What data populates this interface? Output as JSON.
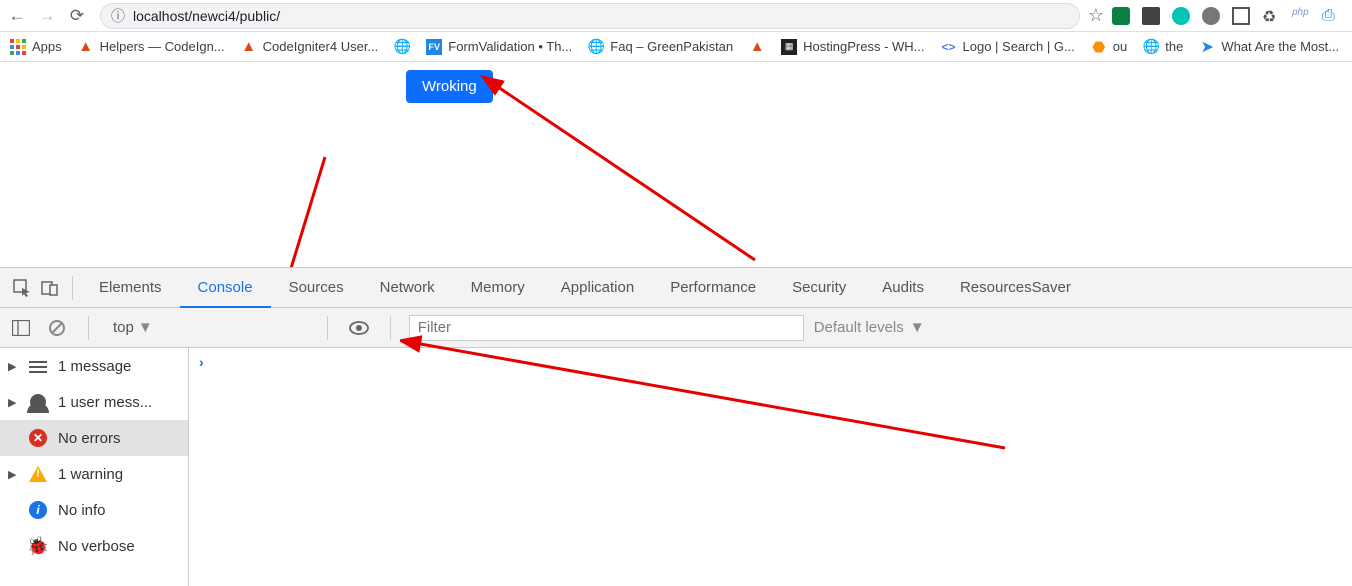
{
  "nav": {
    "url": "localhost/newci4/public/"
  },
  "bookmarks": {
    "apps": "Apps",
    "items": [
      "Helpers — CodeIgn...",
      "CodeIgniter4 User...",
      "FormValidation • Th...",
      "Faq – GreenPakistan",
      "HostingPress - WH...",
      "Logo | Search | G...",
      "ou",
      "the",
      "What Are the Most..."
    ]
  },
  "page": {
    "button_label": "Wroking"
  },
  "devtools": {
    "tabs": [
      "Elements",
      "Console",
      "Sources",
      "Network",
      "Memory",
      "Application",
      "Performance",
      "Security",
      "Audits",
      "ResourcesSaver"
    ],
    "active_tab": "Console",
    "context": "top",
    "filter_placeholder": "Filter",
    "levels": "Default levels",
    "sidebar": [
      {
        "label": "1 message",
        "icon": "message",
        "caret": true
      },
      {
        "label": "1 user mess...",
        "icon": "user",
        "caret": true
      },
      {
        "label": "No errors",
        "icon": "error",
        "caret": false,
        "selected": true
      },
      {
        "label": "1 warning",
        "icon": "warn",
        "caret": true
      },
      {
        "label": "No info",
        "icon": "info",
        "caret": false
      },
      {
        "label": "No verbose",
        "icon": "verbose",
        "caret": false
      }
    ]
  }
}
